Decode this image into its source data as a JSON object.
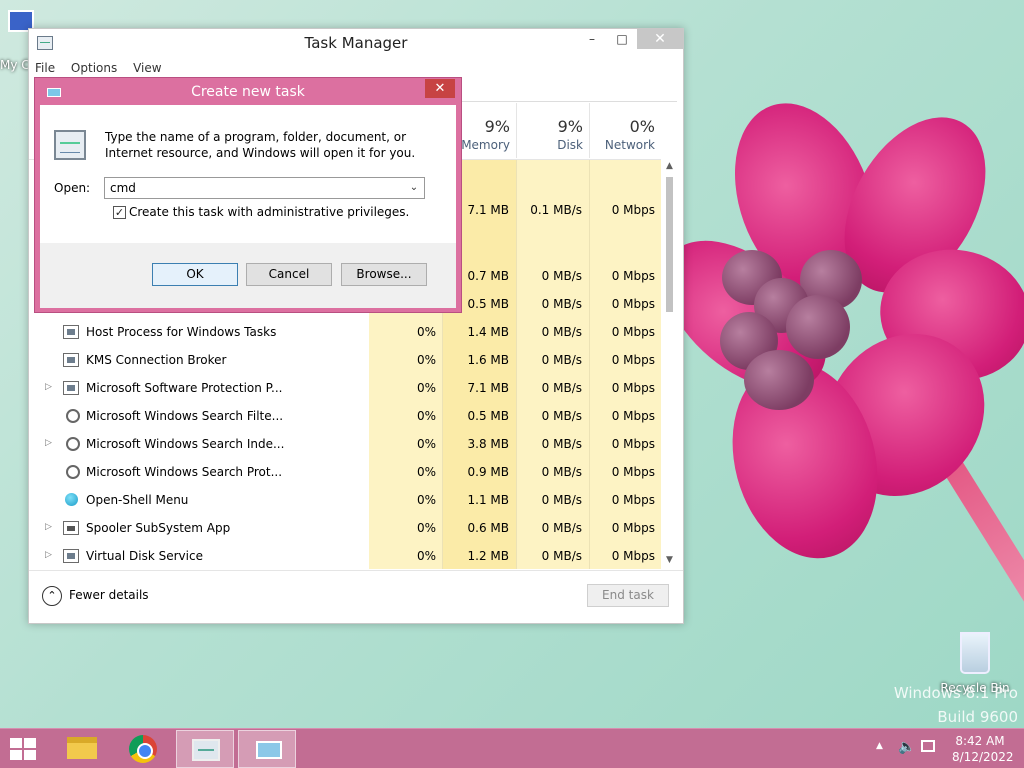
{
  "desktop": {
    "my_computer_label": "My C",
    "recycle_bin_label": "Recycle Bin",
    "watermark_line1": "Windows 8.1 Pro",
    "watermark_line2": "Build 9600"
  },
  "task_manager": {
    "title": "Task Manager",
    "menu": [
      "File",
      "Options",
      "View"
    ],
    "columns": [
      {
        "pct": "9%",
        "label": "Memory"
      },
      {
        "pct": "9%",
        "label": "Disk"
      },
      {
        "pct": "0%",
        "label": "Network"
      }
    ],
    "rows": [
      {
        "name": "",
        "cpu": "",
        "memory": "",
        "disk": "",
        "network": ""
      },
      {
        "name": "",
        "cpu": "",
        "memory": "7.1 MB",
        "disk": "0.1 MB/s",
        "network": "0 Mbps"
      },
      {
        "name": "",
        "cpu": "",
        "memory": "",
        "disk": "",
        "network": ""
      },
      {
        "name": "",
        "cpu": "",
        "memory": "0.7 MB",
        "disk": "0 MB/s",
        "network": "0 Mbps"
      },
      {
        "name": "",
        "cpu": "",
        "memory": "0.5 MB",
        "disk": "0 MB/s",
        "network": "0 Mbps"
      },
      {
        "name": "Host Process for Windows Tasks",
        "cpu": "0%",
        "memory": "1.4 MB",
        "disk": "0 MB/s",
        "network": "0 Mbps"
      },
      {
        "name": "KMS Connection Broker",
        "cpu": "0%",
        "memory": "1.6 MB",
        "disk": "0 MB/s",
        "network": "0 Mbps"
      },
      {
        "name": "Microsoft Software Protection P...",
        "cpu": "0%",
        "memory": "7.1 MB",
        "disk": "0 MB/s",
        "network": "0 Mbps"
      },
      {
        "name": "Microsoft Windows Search Filte...",
        "cpu": "0%",
        "memory": "0.5 MB",
        "disk": "0 MB/s",
        "network": "0 Mbps"
      },
      {
        "name": "Microsoft Windows Search Inde...",
        "cpu": "0%",
        "memory": "3.8 MB",
        "disk": "0 MB/s",
        "network": "0 Mbps"
      },
      {
        "name": "Microsoft Windows Search Prot...",
        "cpu": "0%",
        "memory": "0.9 MB",
        "disk": "0 MB/s",
        "network": "0 Mbps"
      },
      {
        "name": "Open-Shell Menu",
        "cpu": "0%",
        "memory": "1.1 MB",
        "disk": "0 MB/s",
        "network": "0 Mbps"
      },
      {
        "name": "Spooler SubSystem App",
        "cpu": "0%",
        "memory": "0.6 MB",
        "disk": "0 MB/s",
        "network": "0 Mbps"
      },
      {
        "name": "Virtual Disk Service",
        "cpu": "0%",
        "memory": "1.2 MB",
        "disk": "0 MB/s",
        "network": "0 Mbps"
      }
    ],
    "fewer_details": "Fewer details",
    "end_task": "End task"
  },
  "dialog": {
    "title": "Create new task",
    "message": "Type the name of a program, folder, document, or Internet resource, and Windows will open it for you.",
    "open_label": "Open:",
    "open_value": "cmd",
    "admin_checkbox_label": "Create this task with administrative privileges.",
    "admin_checked": true,
    "ok": "OK",
    "cancel": "Cancel",
    "browse": "Browse..."
  },
  "taskbar": {
    "time": "8:42 AM",
    "date": "8/12/2022"
  },
  "colors": {
    "taskbar": "#c26d93",
    "dialog_frame": "#dc70a0",
    "cpu_column": "#fdf3c4",
    "memory_column": "#fbeba8"
  }
}
